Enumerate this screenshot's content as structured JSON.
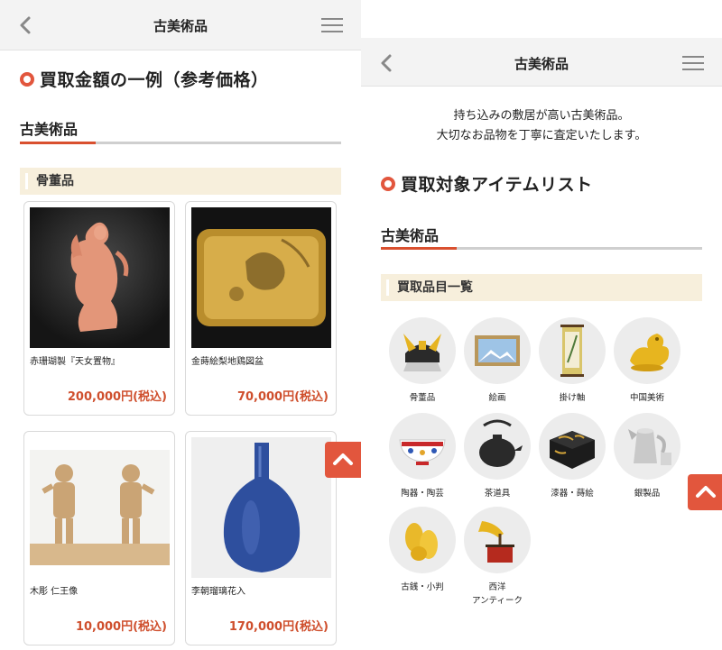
{
  "left": {
    "header_title": "古美術品",
    "section_title": "買取金額の一例（参考価格）",
    "category_tab": "古美術品",
    "sub_header": "骨董品",
    "cards": [
      {
        "name": "赤珊瑚製『天女置物』",
        "price": "200,000円(税込)"
      },
      {
        "name": "金蒔絵梨地鶏図盆",
        "price": "70,000円(税込)"
      },
      {
        "name": "木彫 仁王像",
        "price": "10,000円(税込)"
      },
      {
        "name": "李朝瑠璃花入",
        "price": "170,000円(税込)"
      }
    ]
  },
  "right": {
    "header_title": "古美術品",
    "intro_line1": "持ち込みの敷居が高い古美術品。",
    "intro_line2": "大切なお品物を丁寧に査定いたします。",
    "section_title": "買取対象アイテムリスト",
    "category_tab": "古美術品",
    "sub_header": "買取品目一覧",
    "items": [
      {
        "label": "骨董品",
        "icon": "kabuto-helmet-icon"
      },
      {
        "label": "絵画",
        "icon": "framed-painting-icon"
      },
      {
        "label": "掛け軸",
        "icon": "hanging-scroll-icon"
      },
      {
        "label": "中国美術",
        "icon": "gold-dragon-icon"
      },
      {
        "label": "陶器・陶芸",
        "icon": "porcelain-bowl-icon"
      },
      {
        "label": "茶道具",
        "icon": "iron-teapot-icon"
      },
      {
        "label": "漆器・蒔絵",
        "icon": "lacquer-box-icon"
      },
      {
        "label": "銀製品",
        "icon": "silver-teapot-icon"
      },
      {
        "label": "古銭・小判",
        "icon": "gold-coin-icon"
      },
      {
        "label": "西洋\nアンティーク",
        "icon": "gramophone-icon"
      }
    ]
  },
  "colors": {
    "accent": "#e2563d",
    "price": "#cf4f2d",
    "subheader_bg": "#f7efdc"
  }
}
